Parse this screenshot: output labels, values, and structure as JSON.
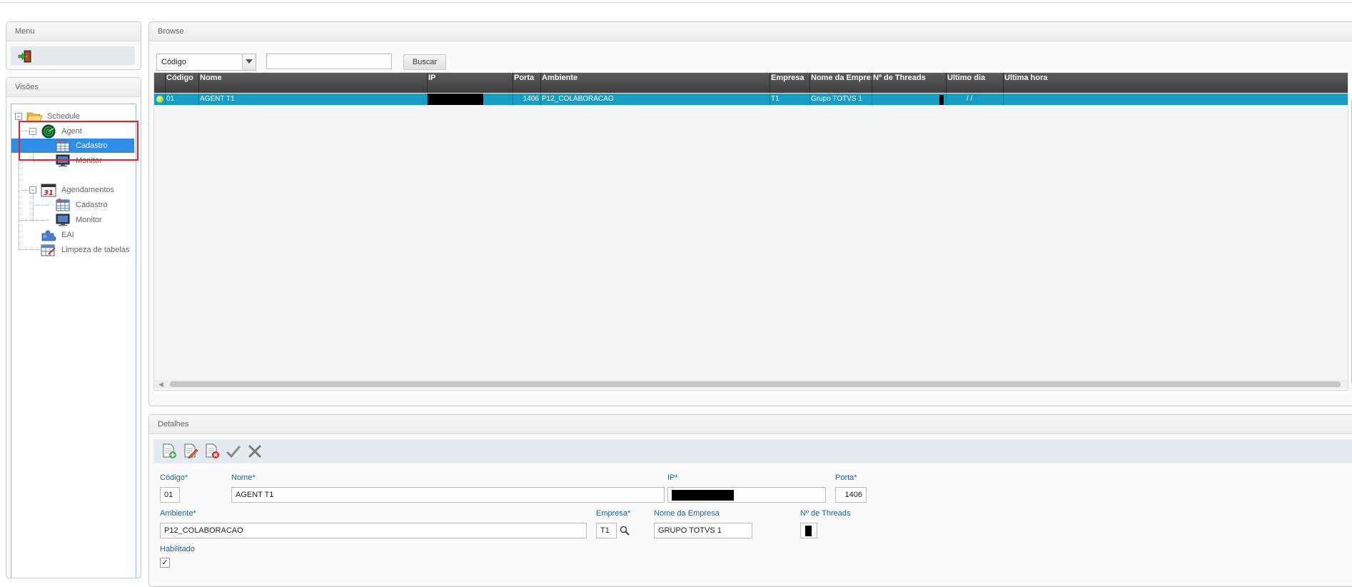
{
  "menu": {
    "title": "Menu",
    "exit_icon": "exit-door-icon"
  },
  "visoes": {
    "title": "Visões",
    "tree": {
      "schedule": "Schedule",
      "agent": "Agent",
      "agent_cadastro": "Cadastro",
      "agent_monitor": "Monitor",
      "agendamentos": "Agendamentos",
      "agend_cadastro": "Cadastro",
      "agend_monitor": "Monitor",
      "eai": "EAI",
      "limpeza": "Limpeza de tabelas"
    }
  },
  "browse": {
    "title": "Browse",
    "search_field": "Código",
    "search_value": "",
    "search_button": "Buscar",
    "columns": {
      "codigo": "Código",
      "nome": "Nome",
      "ip": "IP",
      "porta": "Porta",
      "ambiente": "Ambiente",
      "empresa": "Empresa",
      "nome_empresa": "Nome da Empresa",
      "threads": "Nº de Threads",
      "ultimo_dia": "Ultimo dia",
      "ultima_hora": "Ultima hora"
    },
    "rows": [
      {
        "codigo": "01",
        "nome": "AGENT T1",
        "porta": "1406",
        "ambiente": "P12_COLABORACAO",
        "empresa": "T1",
        "nome_empresa": "Grupo TOTVS 1",
        "ultimo_dia": "/ /",
        "ultima_hora": ""
      }
    ]
  },
  "detalhes": {
    "title": "Detalhes",
    "labels": {
      "codigo": "Código*",
      "nome": "Nome*",
      "ip": "IP*",
      "porta": "Porta*",
      "ambiente": "Ambiente*",
      "empresa": "Empresa*",
      "nome_empresa": "Nome da Empresa",
      "threads": "Nº de Threads",
      "habilitado": "Habilitado"
    },
    "values": {
      "codigo": "01",
      "nome": "AGENT T1",
      "porta": "1406",
      "ambiente": "P12_COLABORACAO",
      "empresa": "T1",
      "nome_empresa": "GRUPO TOTVS 1",
      "habilitado": "✓"
    }
  },
  "colors": {
    "selected_row": "#159dc4",
    "tree_selected": "#2f8fe6",
    "annotation": "#e0242b",
    "label_blue": "#1f5f9f"
  }
}
